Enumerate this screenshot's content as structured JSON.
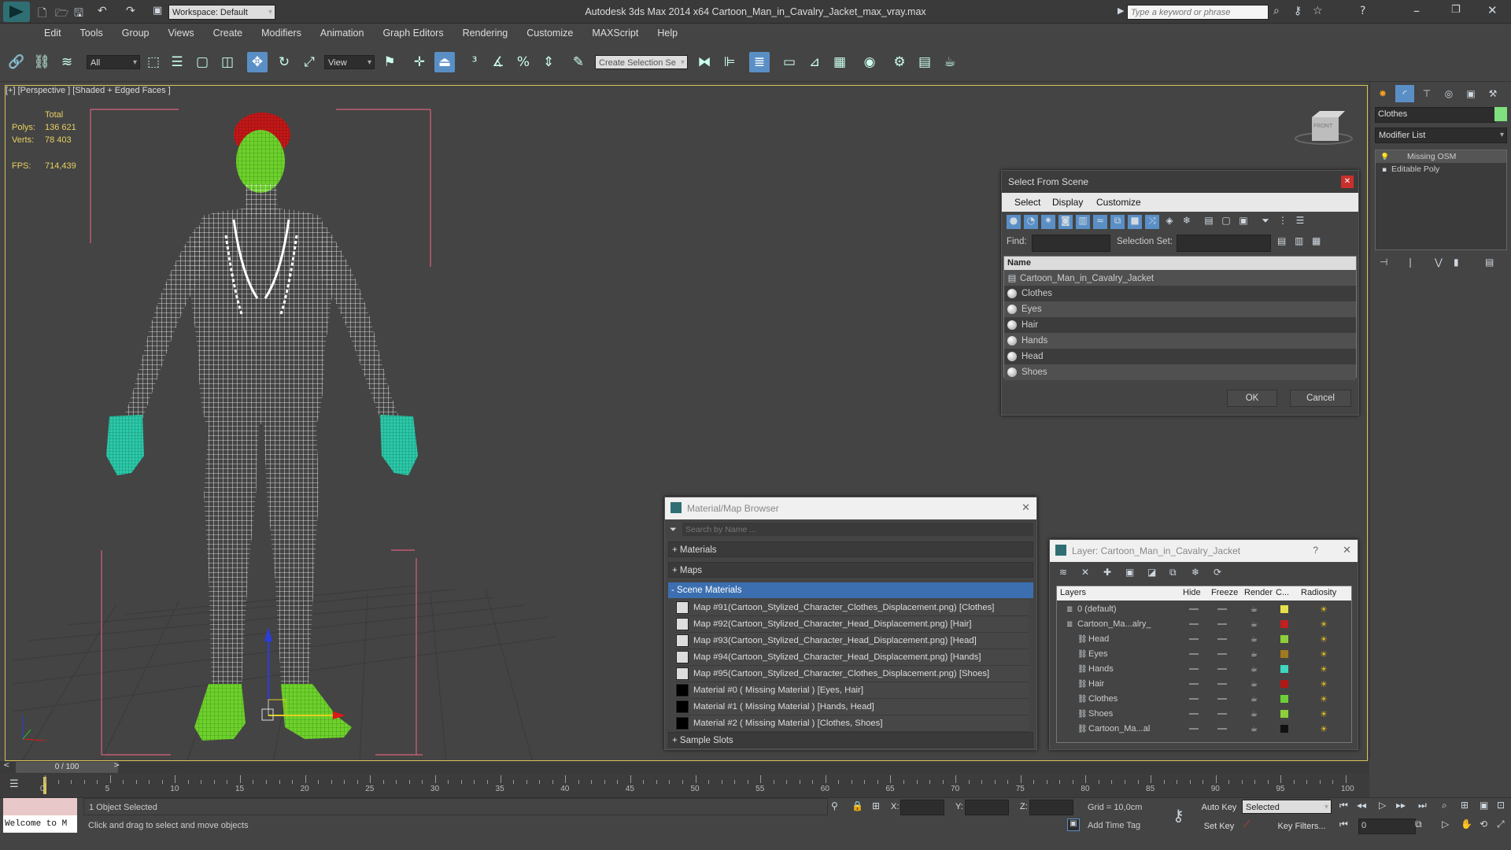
{
  "window": {
    "title": "Autodesk 3ds Max  2014 x64      Cartoon_Man_in_Cavalry_Jacket_max_vray.max",
    "workspace": "Workspace: Default",
    "search_placeholder": "Type a keyword or phrase"
  },
  "menu": [
    "Edit",
    "Tools",
    "Group",
    "Views",
    "Create",
    "Modifiers",
    "Animation",
    "Graph Editors",
    "Rendering",
    "Customize",
    "MAXScript",
    "Help"
  ],
  "toolbar": {
    "filter": "All",
    "ref_coord": "View",
    "selection_set": "Create Selection Se"
  },
  "viewport": {
    "label": "[+] [Perspective ] [Shaded + Edged Faces ]",
    "stats": {
      "total_label": "Total",
      "polys_label": "Polys:",
      "polys": "136 621",
      "verts_label": "Verts:",
      "verts": "78 403",
      "fps_label": "FPS:",
      "fps": "714,439"
    },
    "viewcube_label": "FRONT"
  },
  "select_from_scene": {
    "title": "Select From Scene",
    "tabs": [
      "Select",
      "Display",
      "Customize"
    ],
    "find_label": "Find:",
    "selset_label": "Selection Set:",
    "col_name": "Name",
    "items": [
      "Cartoon_Man_in_Cavalry_Jacket",
      "Clothes",
      "Eyes",
      "Hair",
      "Hands",
      "Head",
      "Shoes"
    ],
    "ok": "OK",
    "cancel": "Cancel"
  },
  "material_browser": {
    "title": "Material/Map Browser",
    "search_placeholder": "Search by Name ...",
    "groups": {
      "materials": "+ Materials",
      "maps": "+ Maps",
      "scene": "- Scene Materials",
      "samples": "+ Sample Slots"
    },
    "items": [
      {
        "text": "Map #91(Cartoon_Stylized_Character_Clothes_Displacement.png) [Clothes]",
        "swatch": "#dddddd"
      },
      {
        "text": "Map #92(Cartoon_Stylized_Character_Head_Displacement.png) [Hair]",
        "swatch": "#dddddd"
      },
      {
        "text": "Map #93(Cartoon_Stylized_Character_Head_Displacement.png) [Head]",
        "swatch": "#dddddd"
      },
      {
        "text": "Map #94(Cartoon_Stylized_Character_Head_Displacement.png) [Hands]",
        "swatch": "#dddddd"
      },
      {
        "text": "Map #95(Cartoon_Stylized_Character_Clothes_Displacement.png) [Shoes]",
        "swatch": "#dddddd"
      },
      {
        "text": "Material #0  ( Missing Material )  [Eyes, Hair]",
        "swatch": "#000000"
      },
      {
        "text": "Material #1  ( Missing Material )  [Hands, Head]",
        "swatch": "#000000"
      },
      {
        "text": "Material #2  ( Missing Material )  [Clothes, Shoes]",
        "swatch": "#000000"
      }
    ]
  },
  "layer_dialog": {
    "title": "Layer: Cartoon_Man_in_Cavalry_Jacket",
    "help": "?",
    "cols": [
      "Layers",
      "Hide",
      "Freeze",
      "Render",
      "C...",
      "Radiosity"
    ],
    "rows": [
      {
        "name": "0 (default)",
        "indent": 0,
        "color": "#e8e04a"
      },
      {
        "name": "Cartoon_Ma...alry_",
        "indent": 0,
        "color": "#c02020"
      },
      {
        "name": "Head",
        "indent": 1,
        "color": "#8ccf3a"
      },
      {
        "name": "Eyes",
        "indent": 1,
        "color": "#a07a1e"
      },
      {
        "name": "Hands",
        "indent": 1,
        "color": "#3ed6c0"
      },
      {
        "name": "Hair",
        "indent": 1,
        "color": "#b01818"
      },
      {
        "name": "Clothes",
        "indent": 1,
        "color": "#6ccf3a"
      },
      {
        "name": "Shoes",
        "indent": 1,
        "color": "#8ccf3a"
      },
      {
        "name": "Cartoon_Ma...al",
        "indent": 1,
        "color": "#111111"
      }
    ]
  },
  "command_panel": {
    "object_name": "Clothes",
    "object_color": "#7ee07e",
    "modifier_list": "Modifier List",
    "stack": [
      "Missing OSM",
      "Editable Poly"
    ]
  },
  "timeline": {
    "frame": "0 / 100",
    "ticks": [
      "0",
      "5",
      "10",
      "15",
      "20",
      "25",
      "30",
      "35",
      "40",
      "45",
      "50",
      "55",
      "60",
      "65",
      "70",
      "75",
      "80",
      "85",
      "90",
      "95",
      "100"
    ]
  },
  "status": {
    "script_text": "Welcome to M",
    "selected": "1 Object Selected",
    "prompt": "Click and drag to select and move objects",
    "x_label": "X:",
    "y_label": "Y:",
    "z_label": "Z:",
    "grid": "Grid = 10,0cm",
    "add_time_tag": "Add Time Tag",
    "auto_key": "Auto Key",
    "set_key": "Set Key",
    "selected_dd": "Selected",
    "key_filters": "Key Filters...",
    "frame_value": "0"
  }
}
